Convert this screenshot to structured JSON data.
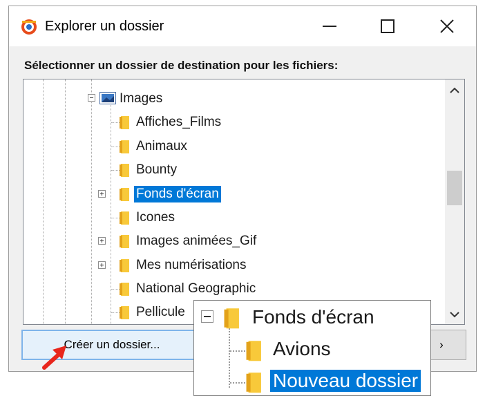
{
  "window": {
    "title": "Explorer un dossier",
    "minimize_glyph": "—",
    "maximize_glyph": "☐",
    "close_glyph": "✕"
  },
  "prompt": "Sélectionner un dossier de destination pour les fichiers:",
  "tree": {
    "root": {
      "label": "Images",
      "icon": "image-library-icon",
      "expanded": true
    },
    "children": [
      {
        "label": "Affiches_Films",
        "has_children": false,
        "selected": false
      },
      {
        "label": "Animaux",
        "has_children": false,
        "selected": false
      },
      {
        "label": "Bounty",
        "has_children": false,
        "selected": false
      },
      {
        "label": "Fonds d'écran",
        "has_children": true,
        "selected": true
      },
      {
        "label": "Icones",
        "has_children": false,
        "selected": false
      },
      {
        "label": "Images animées_Gif",
        "has_children": true,
        "selected": false
      },
      {
        "label": "Mes numérisations",
        "has_children": true,
        "selected": false
      },
      {
        "label": "National Geographic",
        "has_children": false,
        "selected": false
      },
      {
        "label": "Pellicule",
        "has_children": false,
        "selected": false
      }
    ]
  },
  "buttons": {
    "create_folder": "Créer un dossier...",
    "ok_partial": "›"
  },
  "zoom": {
    "parent": {
      "label": "Fonds d'écran",
      "expanded": true
    },
    "children": [
      {
        "label": "Avions",
        "selected": false
      },
      {
        "label": "Nouveau dossier",
        "selected": true
      }
    ]
  },
  "colors": {
    "selection": "#0078d7",
    "folder": "#f8c93a",
    "arrow": "#e8261c"
  }
}
